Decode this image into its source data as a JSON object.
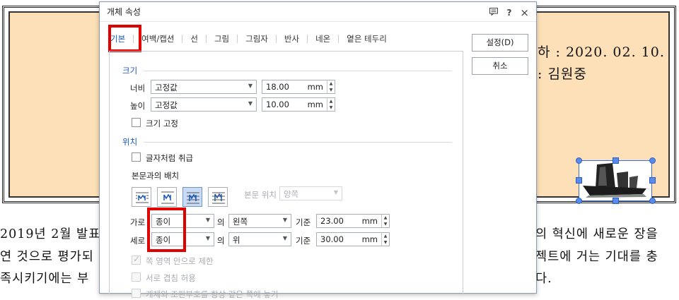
{
  "document": {
    "date_line": "하 : 2020. 02. 10.",
    "author_line": ": 김원중",
    "body_lines": [
      {
        "left": "2019년 2월 발표",
        "right": "의 혁신에 새로운 장을"
      },
      {
        "left": "연 것으로 평가되",
        "right": "젝트에 거는 기대를 충"
      },
      {
        "left": "족시키기에는 부",
        "right": "다."
      }
    ]
  },
  "dialog": {
    "title": "개체 속성",
    "title_icons": {
      "help": "?",
      "close": "×"
    },
    "tabs": [
      {
        "label": "기본",
        "active": true
      },
      {
        "label": "여백/캡션"
      },
      {
        "label": "선"
      },
      {
        "label": "그림"
      },
      {
        "label": "그림자"
      },
      {
        "label": "반사"
      },
      {
        "label": "네온"
      },
      {
        "label": "옅은 테두리"
      }
    ],
    "buttons": {
      "ok": "설정(D)",
      "cancel": "취소"
    },
    "size": {
      "section": "크기",
      "width_label": "너비",
      "width_mode": "고정값",
      "width_value": "18.00",
      "height_label": "높이",
      "height_mode": "고정값",
      "height_value": "10.00",
      "unit": "mm",
      "lock_label": "크기 고정"
    },
    "position": {
      "section": "위치",
      "treat_as_char": "글자처럼 취급",
      "wrap_label": "본문과의 배치",
      "text_pos_label": "본문 위치",
      "text_pos_value": "양쪽",
      "horiz_label": "가로",
      "horiz_ref": "종이",
      "of": "의",
      "horiz_align": "왼쪽",
      "base": "기준",
      "horiz_value": "23.00",
      "vert_label": "세로",
      "vert_ref": "종이",
      "vert_align": "위",
      "vert_value": "30.00",
      "unit": "mm",
      "restrict": "쪽 영역 안으로 제한",
      "overlap": "서로 겹침 허용",
      "anchor_partial": "개체와 조판부호를 항상 같은 쪽에 놓기"
    }
  },
  "colors": {
    "doc_box": "#fde0b8",
    "accent": "#1a56b8",
    "highlight": "#e00000",
    "selection": "#5b8be8"
  }
}
